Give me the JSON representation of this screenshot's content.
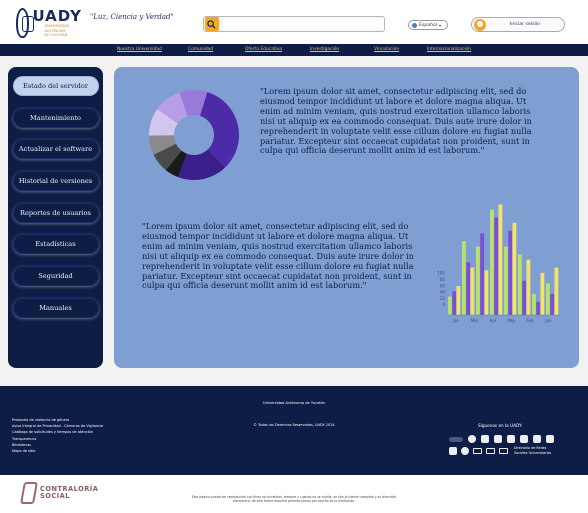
{
  "header": {
    "logo_text": "UADY",
    "logo_sub": [
      "UNIVERSIDAD",
      "AUTÓNOMA",
      "DE YUCATÁN"
    ],
    "motto": "\"Luz, Ciencia y Verdad\"",
    "search_placeholder": "",
    "language": "Español",
    "login_label": "Iniciar sesión"
  },
  "nav": [
    "Nuestra Universidad",
    "Comunidad",
    "Oferta Educativa",
    "Investigación",
    "Vinculación",
    "Internacionalización"
  ],
  "sidebar": [
    "Estado del servidor",
    "Mantenimiento",
    "Actualizar el software",
    "Historial de versiones",
    "Reportes de usuarios",
    "Estadísticas",
    "Seguridad",
    "Manuales"
  ],
  "content": {
    "paragraph_1": "\"Lorem ipsum dolor sit amet, consectetur adipiscing elit, sed do eiusmod tempor incididunt ut labore et dolore magna aliqua. Ut enim ad minim veniam, quis nostrud exercitation ullamco laboris nisi ut aliquip ex ea commodo consequat. Duis aute irure dolor in reprehenderit in voluptate velit esse cillum dolore eu fugiat nulla pariatur. Excepteur sint occaecat cupidatat non proident, sunt in culpa qui officia deserunt mollit anim id est laborum.\"",
    "paragraph_2": "\"Lorem ipsum dolor sit amet, consectetur adipiscing elit, sed do eiusmod tempor incididunt ut labore et dolore magna aliqua. Ut enim ad minim veniam, quis nostrud exercitation ullamco laboris nisi ut aliquip ex ea commodo consequat. Duis aute irure dolor in reprehenderit in voluptate velit esse cillum dolore eu fugiat nulla pariatur. Excepteur sint occaecat cupidatat non proident, sunt in culpa qui officia deserunt mollit anim id est laborum.\""
  },
  "chart_data": [
    {
      "type": "pie",
      "title": "",
      "values": [
        33,
        18,
        5,
        7,
        7,
        10,
        10,
        10
      ],
      "colors": [
        "#4c2aa8",
        "#3a1f8a",
        "#1a1a1a",
        "#4a4a4a",
        "#8a8a8a",
        "#d0c6ee",
        "#b79ee6",
        "#9a7ad8"
      ]
    },
    {
      "type": "bar",
      "title": "",
      "categories": [
        "Jan",
        "Mar",
        "Apr",
        "May",
        "Feb",
        "Jun",
        "Jan",
        "Mar"
      ],
      "tick_labels": [
        "Jan",
        "Mar",
        "Apr",
        "May",
        "Feb",
        "Jun"
      ],
      "y_ticks": [
        "0",
        "20",
        "40",
        "60",
        "80",
        "100"
      ],
      "ylim": [
        0,
        205
      ],
      "series": [
        {
          "color": "#b8e06a",
          "values": [
            35,
            140,
            130,
            200,
            130,
            115,
            40,
            60
          ]
        },
        {
          "color": "#7a4fd6",
          "values": [
            45,
            100,
            155,
            185,
            160,
            65,
            25,
            40
          ]
        },
        {
          "color": "#f2e36a",
          "values": [
            55,
            90,
            85,
            210,
            175,
            105,
            80,
            90
          ]
        }
      ]
    }
  ],
  "footer": {
    "university": "Universidad Autónoma de Yucatán",
    "links": [
      "Protocolo de violencia de género",
      "Aviso Integral de Privacidad - Cámaras de Vigilancia",
      "Catálogo de solicitudes y tiempos de atención",
      "Transparencia",
      "Bibliotecas",
      "Mapa de sitio"
    ],
    "copyright": "© Todos los Derechos Reservados, UADY 2024",
    "follow": "Síguenos en la UADY:",
    "redes": [
      "Directorio de Redes",
      "Sociales Universitarias"
    ]
  },
  "bottom": {
    "contraloria": [
      "CONTRALORÍA",
      "SOCIAL"
    ],
    "disclaimer": "Esta página puede ser reproducida con fines no lucrativos, siempre y cuando no se mutile, se cite la fuente completa y su dirección electrónica, de otra forma requiere permiso previo por escrito de la institución."
  }
}
